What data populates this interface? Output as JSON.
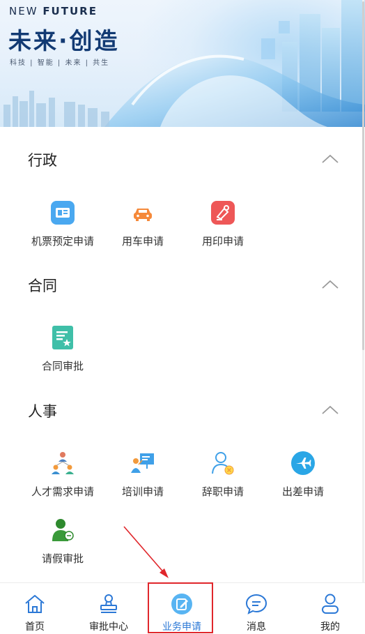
{
  "banner": {
    "en_prefix": "NEW ",
    "en_bold": "FUTURE",
    "title": "未来·创造",
    "subtitle": "科技 | 智能 | 未来 | 共生"
  },
  "sections": [
    {
      "title": "行政",
      "items": [
        {
          "label": "机票预定申请",
          "icon": "ticket-icon",
          "color": "#4aa8f0"
        },
        {
          "label": "用车申请",
          "icon": "car-icon",
          "color": "#f5893a"
        },
        {
          "label": "用印申请",
          "icon": "seal-icon",
          "color": "#ee5757"
        }
      ]
    },
    {
      "title": "合同",
      "items": [
        {
          "label": "合同审批",
          "icon": "contract-icon",
          "color": "#3fbfa8"
        }
      ]
    },
    {
      "title": "人事",
      "items": [
        {
          "label": "人才需求申请",
          "icon": "talent-icon",
          "color": "#f29a3c"
        },
        {
          "label": "培训申请",
          "icon": "training-icon",
          "color": "#3fa0e8"
        },
        {
          "label": "辞职申请",
          "icon": "resign-icon",
          "color": "#4aa8f0"
        },
        {
          "label": "出差申请",
          "icon": "plane-icon",
          "color": "#2aa6e6"
        },
        {
          "label": "请假审批",
          "icon": "leave-icon",
          "color": "#3a9a3a"
        }
      ]
    }
  ],
  "tabbar": {
    "active_color": "#2b78d6",
    "highlight_color": "#e0262b",
    "items": [
      {
        "label": "首页",
        "icon": "home-icon"
      },
      {
        "label": "审批中心",
        "icon": "stamp-icon"
      },
      {
        "label": "业务申请",
        "icon": "edit-icon",
        "active": true
      },
      {
        "label": "消息",
        "icon": "chat-icon"
      },
      {
        "label": "我的",
        "icon": "user-icon"
      }
    ]
  }
}
